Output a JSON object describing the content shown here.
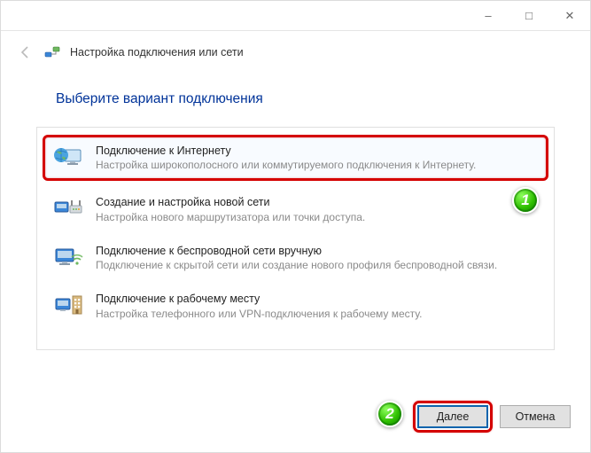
{
  "titlebar": {
    "minimize": "–",
    "maximize": "□",
    "close": "✕"
  },
  "header": {
    "title": "Настройка подключения или сети"
  },
  "page": {
    "title": "Выберите вариант подключения"
  },
  "options": [
    {
      "title": "Подключение к Интернету",
      "desc": "Настройка широкополосного или коммутируемого подключения к Интернету."
    },
    {
      "title": "Создание и настройка новой сети",
      "desc": "Настройка нового маршрутизатора или точки доступа."
    },
    {
      "title": "Подключение к беспроводной сети вручную",
      "desc": "Подключение к скрытой сети или создание нового профиля беспроводной связи."
    },
    {
      "title": "Подключение к рабочему месту",
      "desc": "Настройка телефонного или VPN-подключения к рабочему месту."
    }
  ],
  "badges": {
    "one": "1",
    "two": "2"
  },
  "footer": {
    "next": "Далее",
    "cancel": "Отмена"
  }
}
